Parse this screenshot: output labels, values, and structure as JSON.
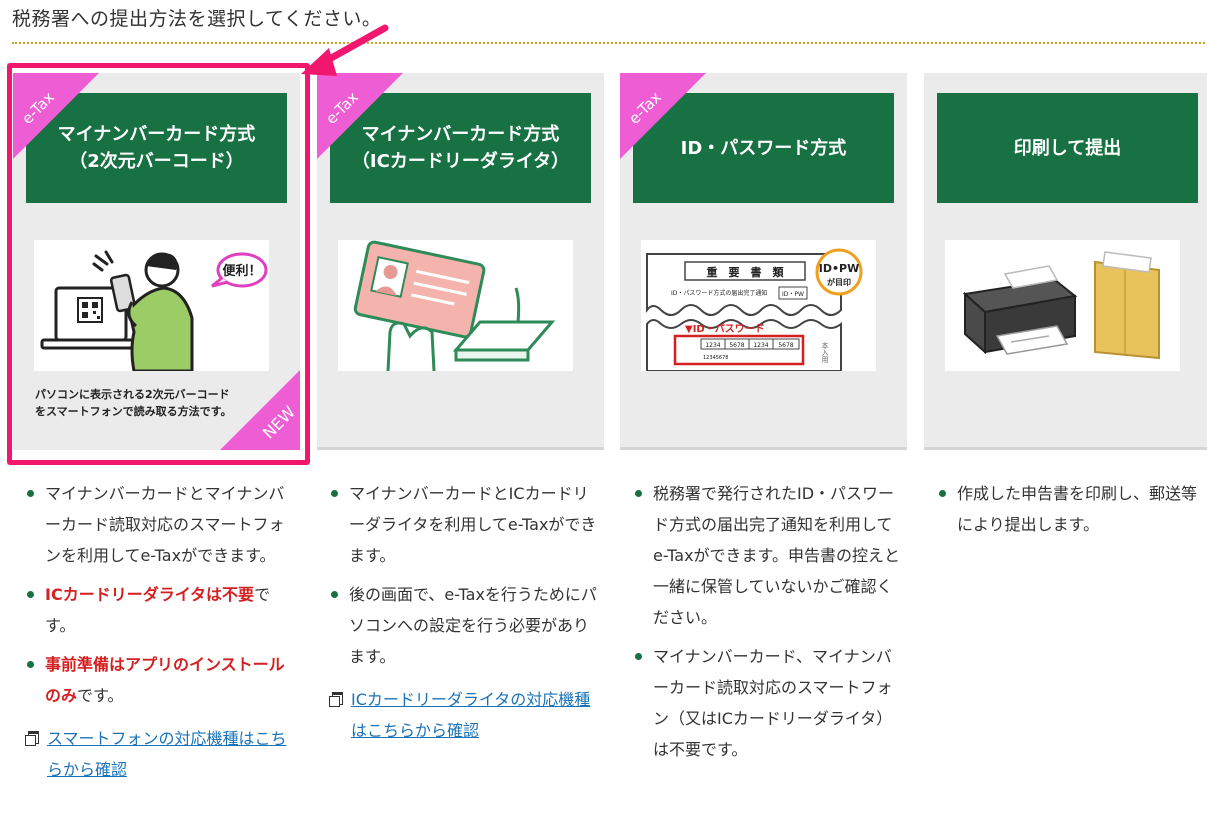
{
  "page": {
    "heading": "税務署への提出方法を選択してください。"
  },
  "cards": [
    {
      "ribbon": "e-Tax",
      "title_line1": "マイナンバーカード方式",
      "title_line2": "（2次元バーコード）",
      "illus_bubble": "便利！",
      "desc_line1": "パソコンに表示される2次元バーコード",
      "desc_line2": "をスマートフォンで読み取る方法です。",
      "badge": "NEW"
    },
    {
      "ribbon": "e-Tax",
      "title_line1": "マイナンバーカード方式",
      "title_line2": "（ICカードリーダライタ）"
    },
    {
      "ribbon": "e-Tax",
      "title_line1": "ID・パスワード方式",
      "doc_title": "重　要　書　類",
      "doc_sub": "ID・パスワード方式の届出完了通知",
      "doc_tag": "ID・PW",
      "stamp_line1": "ID•PW",
      "stamp_line2": "が目印",
      "doc_label": "▼ID・パスワード",
      "doc_nums": [
        "1234",
        "5678",
        "1234",
        "5678"
      ],
      "doc_code": "12345678",
      "doc_side": "本入用"
    },
    {
      "title_line1": "印刷して提出"
    }
  ],
  "details": [
    {
      "items": [
        {
          "parts": [
            {
              "text": "マイナンバーカードとマイナンバーカード読取対応のスマートフォンを利用してe-Taxができます。",
              "em": false
            }
          ]
        },
        {
          "parts": [
            {
              "text": "ICカードリーダライタは不要",
              "em": true
            },
            {
              "text": "です。",
              "em": false
            }
          ]
        },
        {
          "parts": [
            {
              "text": "事前準備はアプリのインストールのみ",
              "em": true
            },
            {
              "text": "です。",
              "em": false
            }
          ]
        }
      ],
      "link": "スマートフォンの対応機種はこちらから確認"
    },
    {
      "items": [
        {
          "parts": [
            {
              "text": "マイナンバーカードとICカードリーダライタを利用してe-Taxができます。",
              "em": false
            }
          ]
        },
        {
          "parts": [
            {
              "text": "後の画面で、e-Taxを行うためにパソコンへの設定を行う必要があります。",
              "em": false
            }
          ]
        }
      ],
      "link": "ICカードリーダライタの対応機種はこちらから確認"
    },
    {
      "items": [
        {
          "parts": [
            {
              "text": "税務署で発行されたID・パスワード方式の届出完了通知を利用してe-Taxができます。申告書の控えと一緒に保管していないかご確認ください。",
              "em": false
            }
          ]
        },
        {
          "parts": [
            {
              "text": "マイナンバーカード、マイナンバーカード読取対応のスマートフォン（又はICカードリーダライタ）は不要です。",
              "em": false
            }
          ]
        }
      ]
    },
    {
      "items": [
        {
          "parts": [
            {
              "text": "作成した申告書を印刷し、郵送等により提出します。",
              "em": false
            }
          ]
        }
      ]
    }
  ],
  "colors": {
    "header_green": "#177143",
    "ribbon_pink": "#ef5dd5",
    "highlight": "#f2176e",
    "emphasis_red": "#d42020",
    "link_blue": "#1a73b8",
    "card_bg": "#ebebeb"
  }
}
